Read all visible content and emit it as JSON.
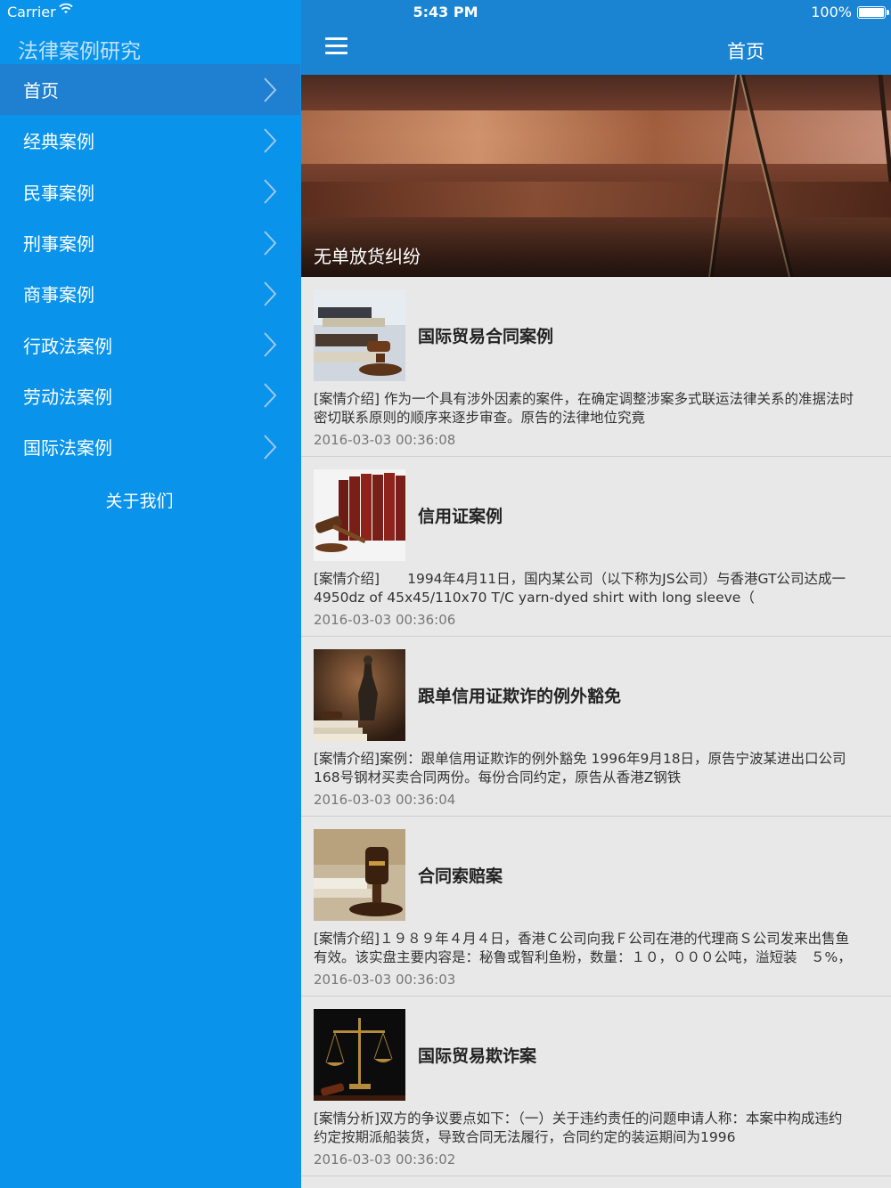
{
  "status_bar": {
    "carrier": "Carrier",
    "time": "5:43 PM",
    "battery": "100%"
  },
  "sidebar": {
    "app_title": "法律案例研究",
    "items": [
      {
        "label": "首页"
      },
      {
        "label": "经典案例"
      },
      {
        "label": "民事案例"
      },
      {
        "label": "刑事案例"
      },
      {
        "label": "商事案例"
      },
      {
        "label": "行政法案例"
      },
      {
        "label": "劳动法案例"
      },
      {
        "label": "国际法案例"
      }
    ],
    "about": "关于我们"
  },
  "navbar": {
    "title": "首页",
    "menu_icon": "hamburger-icon"
  },
  "banner": {
    "caption": "无单放货纠纷"
  },
  "articles": [
    {
      "title": "国际贸易合同案例",
      "summary_line1": "[案情介绍] 作为一个具有涉外因素的案件，在确定调整涉案多式联运法律关系的准据法时",
      "summary_line2": "密切联系原则的顺序来逐步审查。原告的法律地位究竟",
      "date": "2016-03-03 00:36:08"
    },
    {
      "title": "信用证案例",
      "summary_line1": "[案情介绍]　　1994年4月11日，国内某公司（以下称为JS公司）与香港GT公司达成一",
      "summary_line2": "4950dz of 45x45/110x70 T/C yarn-dyed shirt with long sleeve（",
      "date": "2016-03-03 00:36:06"
    },
    {
      "title": "跟单信用证欺诈的例外豁免",
      "summary_line1": "[案情介绍]案例：跟单信用证欺诈的例外豁免 1996年9月18日，原告宁波某进出口公司",
      "summary_line2": "168号钢材买卖合同两份。每份合同约定，原告从香港Z钢铁",
      "date": "2016-03-03 00:36:04"
    },
    {
      "title": "合同索赔案",
      "summary_line1": "[案情介绍]１９８９年４月４日，香港Ｃ公司向我Ｆ公司在港的代理商Ｓ公司发来出售鱼",
      "summary_line2": "有效。该实盘主要内容是：秘鲁或智利鱼粉，数量：１０，０００公吨，溢短装　５%，",
      "date": "2016-03-03 00:36:03"
    },
    {
      "title": "国际贸易欺诈案",
      "summary_line1": "[案情分析]双方的争议要点如下：（一）关于违约责任的问题申请人称：本案中构成违约",
      "summary_line2": "约定按期派船装货，导致合同无法履行，合同约定的装运期间为1996",
      "date": "2016-03-03 00:36:02"
    }
  ],
  "colors": {
    "sidebar_bg": "#0a93ea",
    "sidebar_active": "#1f7fd0",
    "navbar_bg": "#1b84d2",
    "content_bg": "#e8e8e8"
  }
}
